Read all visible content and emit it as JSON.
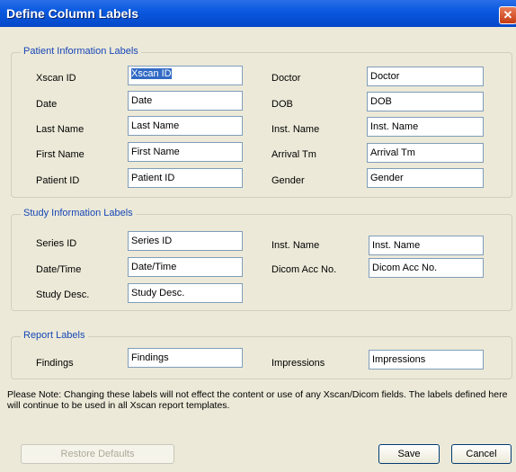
{
  "window": {
    "title": "Define Column Labels",
    "close_glyph": "✕"
  },
  "patient": {
    "legend": "Patient Information Labels",
    "left": [
      {
        "label": "Xscan ID",
        "value": "Xscan ID"
      },
      {
        "label": "Date",
        "value": "Date"
      },
      {
        "label": "Last Name",
        "value": "Last Name"
      },
      {
        "label": "First Name",
        "value": "First Name"
      },
      {
        "label": "Patient ID",
        "value": "Patient ID"
      }
    ],
    "right": [
      {
        "label": "Doctor",
        "value": "Doctor"
      },
      {
        "label": "DOB",
        "value": "DOB"
      },
      {
        "label": "Inst. Name",
        "value": "Inst. Name"
      },
      {
        "label": "Arrival Tm",
        "value": "Arrival Tm"
      },
      {
        "label": "Gender",
        "value": "Gender"
      }
    ]
  },
  "study": {
    "legend": "Study Information Labels",
    "left": [
      {
        "label": "Series ID",
        "value": "Series ID"
      },
      {
        "label": "Date/Time",
        "value": "Date/Time"
      },
      {
        "label": "Study Desc.",
        "value": "Study Desc."
      }
    ],
    "right": [
      {
        "label": "Inst. Name",
        "value": "Inst. Name"
      },
      {
        "label": "Dicom Acc No.",
        "value": "Dicom Acc No."
      }
    ]
  },
  "report": {
    "legend": "Report Labels",
    "left": [
      {
        "label": "Findings",
        "value": "Findings"
      }
    ],
    "right": [
      {
        "label": "Impressions",
        "value": "Impressions"
      }
    ]
  },
  "note": "Please Note: Changing these labels will not effect the content or use of any Xscan/Dicom fields. The labels defined here will continue to be used in all Xscan report templates.",
  "buttons": {
    "restore": "Restore Defaults",
    "save": "Save",
    "cancel": "Cancel"
  }
}
